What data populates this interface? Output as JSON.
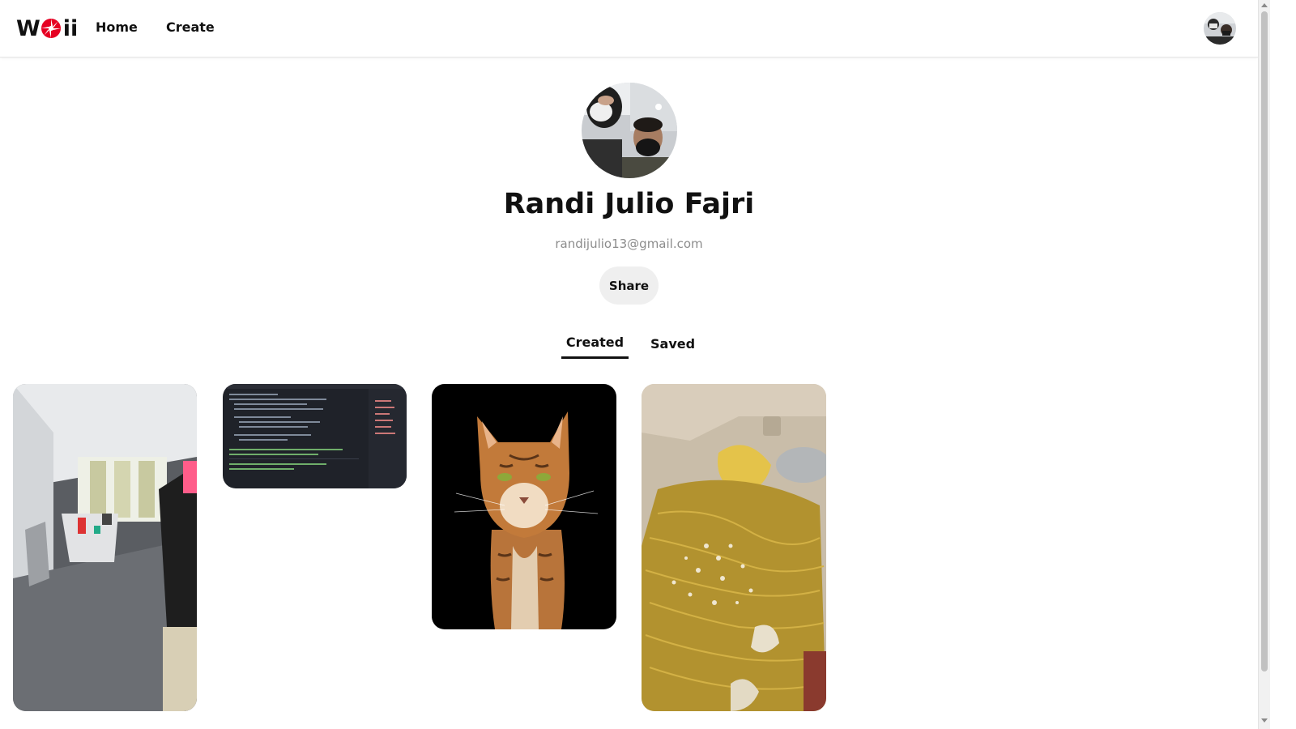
{
  "header": {
    "logo_prefix": "W",
    "logo_suffix": "ii",
    "nav": [
      {
        "label": "Home"
      },
      {
        "label": "Create"
      }
    ]
  },
  "profile": {
    "name": "Randi Julio Fajri",
    "email": "randijulio13@gmail.com",
    "share_label": "Share"
  },
  "tabs": [
    {
      "label": "Created",
      "active": true
    },
    {
      "label": "Saved",
      "active": false
    }
  ],
  "pins": [
    {
      "subject": "office room with tables"
    },
    {
      "subject": "code editor screenshot"
    },
    {
      "subject": "orange tabby cat"
    },
    {
      "subject": "noodles in box"
    }
  ],
  "colors": {
    "logo_accent": "#e60023",
    "email": "#8c8c8c",
    "share_bg": "#efefef"
  }
}
